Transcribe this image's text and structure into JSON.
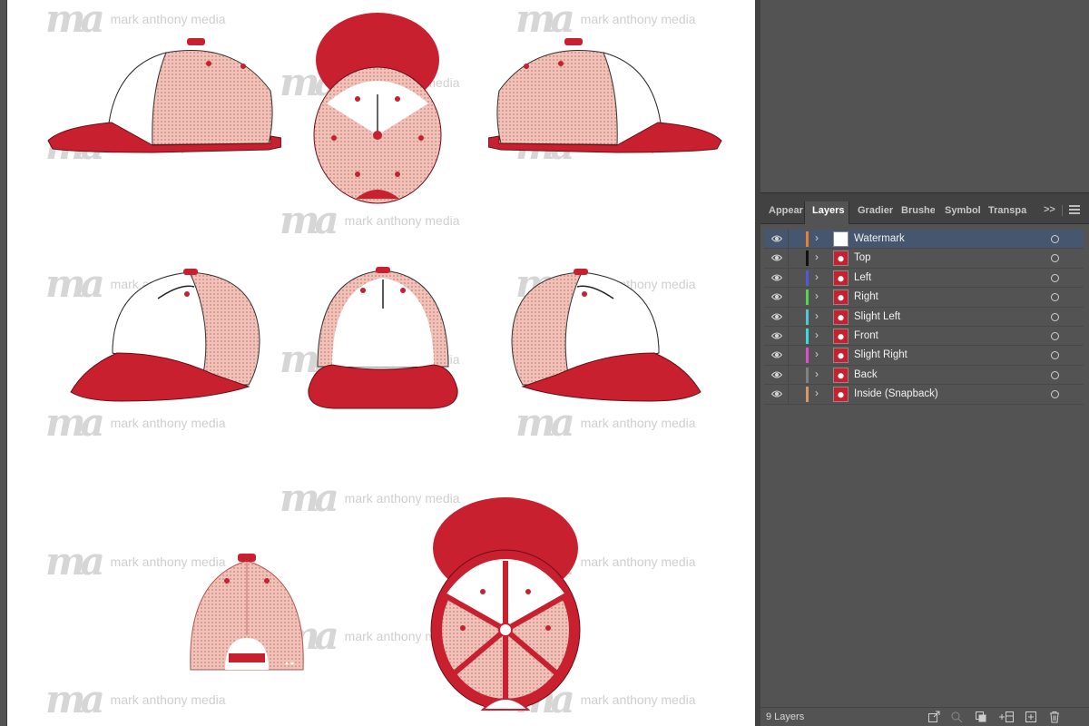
{
  "watermark": {
    "mark": "ma",
    "text": "mark anthony media"
  },
  "panel": {
    "tabs": [
      {
        "label": "Appear",
        "active": false
      },
      {
        "label": "Layers",
        "active": true
      },
      {
        "label": "Gradier",
        "active": false
      },
      {
        "label": "Brushes",
        "active": false
      },
      {
        "label": "Symbol",
        "active": false
      },
      {
        "label": "Transpa",
        "active": false
      }
    ],
    "more_label": ">>",
    "layers": [
      {
        "name": "Watermark",
        "color": "#f07d2a",
        "selected": true
      },
      {
        "name": "Top",
        "color": "#111111",
        "selected": false
      },
      {
        "name": "Left",
        "color": "#5059d6",
        "selected": false
      },
      {
        "name": "Right",
        "color": "#4fd84f",
        "selected": false
      },
      {
        "name": "Slight Left",
        "color": "#4fc8d6",
        "selected": false
      },
      {
        "name": "Front",
        "color": "#40d8e0",
        "selected": false
      },
      {
        "name": "Slight Right",
        "color": "#e04bd0",
        "selected": false
      },
      {
        "name": "Back",
        "color": "#808080",
        "selected": false
      },
      {
        "name": "Inside (Snapback)",
        "color": "#d69866",
        "selected": false
      }
    ],
    "footer": {
      "count_label": "9 Layers"
    }
  },
  "colors": {
    "cap_red": "#c8202f",
    "mesh_pink": "#e9b3a8",
    "crown_white": "#ffffff",
    "panel_bg": "#535353",
    "selection": "#46566e"
  }
}
